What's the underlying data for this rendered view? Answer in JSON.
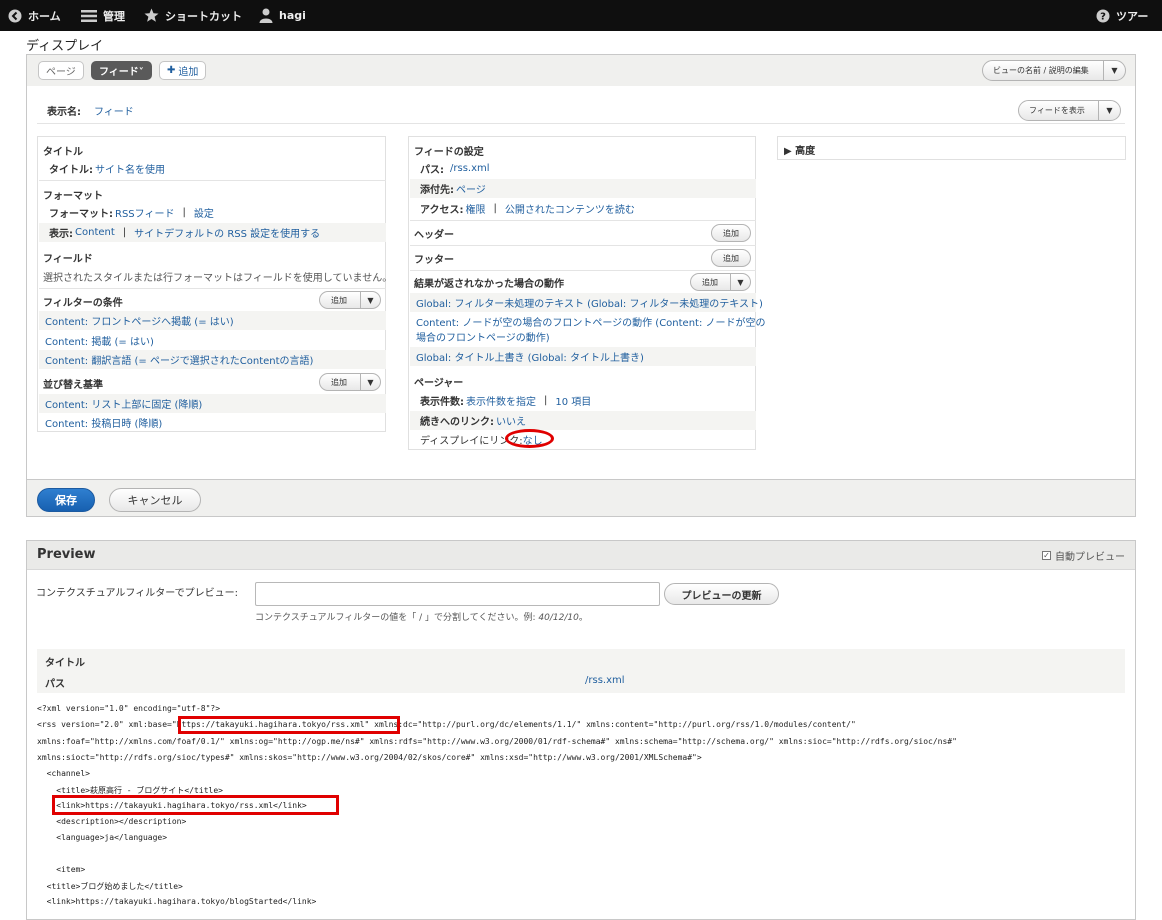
{
  "toolbar": {
    "home": "ホーム",
    "manage": "管理",
    "shortcuts": "ショートカット",
    "user": "hagi",
    "tour": "ツアー"
  },
  "page_title": "ディスプレイ",
  "tabs": {
    "page": "ページ",
    "feed": "フィード˅",
    "add": "追加"
  },
  "edit_name_button": "ビューの名前 / 説明の編集",
  "display_name": {
    "label": "表示名:",
    "value": "フィード"
  },
  "view_feed_button": "フィードを表示",
  "col1": {
    "title_section": "タイトル",
    "title_row": {
      "key": "タイトル:",
      "value": "サイト名を使用"
    },
    "format_section": "フォーマット",
    "format_row": {
      "key": "フォーマット:",
      "value": "RSSフィード",
      "settings": "設定"
    },
    "show_row": {
      "key": "表示:",
      "value": "Content",
      "extra": "サイトデフォルトの RSS 設定を使用する"
    },
    "fields_section": "フィールド",
    "fields_help": "選択されたスタイルまたは行フォーマットはフィールドを使用していません。",
    "filter_section": "フィルターの条件",
    "filters": [
      "Content: フロントページへ掲載 (= はい)",
      "Content: 掲載 (= はい)",
      "Content: 翻訳言語 (= ページで選択されたContentの言語)"
    ],
    "sort_section": "並び替え基準",
    "sorts": [
      "Content: リスト上部に固定 (降順)",
      "Content: 投稿日時 (降順)"
    ],
    "add_label": "追加"
  },
  "col2": {
    "feed_section": "フィードの設定",
    "path_row": {
      "key": "パス:",
      "value": "/rss.xml"
    },
    "attach_row": {
      "key": "添付先:",
      "value": "ページ"
    },
    "access_row": {
      "key": "アクセス:",
      "value": "権限",
      "extra": "公開されたコンテンツを読む"
    },
    "header_section": "ヘッダー",
    "footer_section": "フッター",
    "empty_section": "結果が返されなかった場合の動作",
    "empty_items": [
      "Global: フィルター未処理のテキスト (Global: フィルター未処理のテキスト)",
      "Content: ノードが空の場合のフロントページの動作 (Content: ノードが空の",
      "場合のフロントページの動作)",
      "Global: タイトル上書き (Global: タイトル上書き)"
    ],
    "pager_section": "ページャー",
    "items_row": {
      "key": "表示件数:",
      "value": "表示件数を指定",
      "extra": "10 項目"
    },
    "more_row": {
      "key": "続きへのリンク:",
      "value": "いいえ"
    },
    "link_display_row": {
      "key": "ディスプレイにリンク:",
      "value": "なし"
    },
    "add_label": "追加"
  },
  "col3": {
    "advanced": "▶ 高度"
  },
  "save_button": "保存",
  "cancel_button": "キャンセル",
  "preview": {
    "heading": "Preview",
    "auto_preview": "自動プレビュー",
    "ctx_label": "コンテクスチュアルフィルターでプレビュー:",
    "ctx_input_value": "",
    "update_button": "プレビューの更新",
    "ctx_help_prefix": "コンテクスチュアルフィルターの値を「 / 」で分割してください。例: ",
    "ctx_help_example": "40/12/10",
    "ctx_help_suffix": "。",
    "table_title": "タイトル",
    "table_path_key": "パス",
    "table_path_value": "/rss.xml",
    "xml_lines": [
      "<?xml version=\"1.0\" encoding=\"utf-8\"?>",
      "<rss version=\"2.0\" xml:base=\"https://takayuki.hagihara.tokyo/rss.xml\" xmlns:dc=\"http://purl.org/dc/elements/1.1/\" xmlns:content=\"http://purl.org/rss/1.0/modules/content/\"",
      "xmlns:foaf=\"http://xmlns.com/foaf/0.1/\" xmlns:og=\"http://ogp.me/ns#\" xmlns:rdfs=\"http://www.w3.org/2000/01/rdf-schema#\" xmlns:schema=\"http://schema.org/\" xmlns:sioc=\"http://rdfs.org/sioc/ns#\"",
      "xmlns:sioct=\"http://rdfs.org/sioc/types#\" xmlns:skos=\"http://www.w3.org/2004/02/skos/core#\" xmlns:xsd=\"http://www.w3.org/2001/XMLSchema#\">",
      "  <channel>",
      "    <title>萩原高行 - ブログサイト</title>",
      "    <link>https://takayuki.hagihara.tokyo/rss.xml</link>",
      "    <description></description>",
      "    <language>ja</language>",
      "",
      "    <item>",
      "  <title>ブログ始めました</title>",
      "  <link>https://takayuki.hagihara.tokyo/blogStarted</link>"
    ]
  }
}
